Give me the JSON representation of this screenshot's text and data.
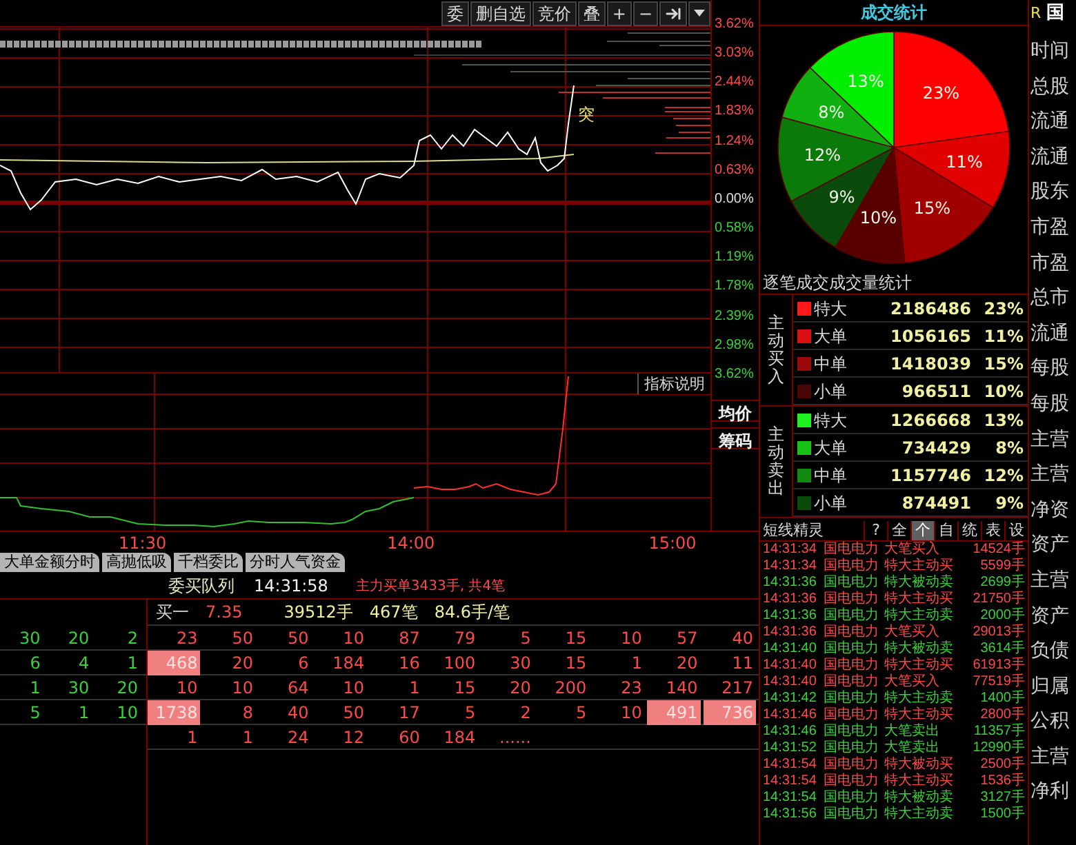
{
  "toolbar": [
    {
      "kind": "text",
      "label": "委"
    },
    {
      "kind": "text",
      "label": "删自选"
    },
    {
      "kind": "text",
      "label": "竞价"
    },
    {
      "kind": "text",
      "label": "叠"
    },
    {
      "kind": "text",
      "label": "+"
    },
    {
      "kind": "text",
      "label": "−"
    },
    {
      "kind": "jump-end"
    },
    {
      "kind": "dropdown"
    }
  ],
  "price_axis": [
    {
      "label": "3.62%",
      "kind": "up"
    },
    {
      "label": "3.03%",
      "kind": "up"
    },
    {
      "label": "2.44%",
      "kind": "up"
    },
    {
      "label": "1.83%",
      "kind": "up"
    },
    {
      "label": "1.24%",
      "kind": "up"
    },
    {
      "label": "0.63%",
      "kind": "up"
    },
    {
      "label": "0.00%",
      "kind": "flat"
    },
    {
      "label": "0.58%",
      "kind": "down"
    },
    {
      "label": "1.19%",
      "kind": "down"
    },
    {
      "label": "1.78%",
      "kind": "down"
    },
    {
      "label": "2.39%",
      "kind": "down"
    },
    {
      "label": "2.98%",
      "kind": "down"
    },
    {
      "label": "3.62%",
      "kind": "down"
    }
  ],
  "signal_label": "突",
  "indicator": {
    "help_button": "指标说明",
    "side_buttons": [
      "均价",
      "筹码"
    ]
  },
  "time_axis": [
    "11:30",
    "14:00",
    "15:00"
  ],
  "indicator_tabs": [
    "大单金额分时",
    "高抛低吸",
    "千档委比",
    "分时人气资金"
  ],
  "queue": {
    "title": "委买队列",
    "time": "14:31:58",
    "summary": "主力买单3433手, 共4笔",
    "level": "买一",
    "price": "7.35",
    "volume": "39512手",
    "count": "467笔",
    "average": "84.6手/笔",
    "side_rows": [
      [
        "30",
        "20",
        "2"
      ],
      [
        "6",
        "4",
        "1"
      ],
      [
        "1",
        "30",
        "20"
      ],
      [
        "5",
        "1",
        "10"
      ]
    ],
    "rows": [
      [
        {
          "text": "23",
          "highlighted": false
        },
        {
          "text": "50",
          "highlighted": false
        },
        {
          "text": "50",
          "highlighted": false
        },
        {
          "text": "10",
          "highlighted": false
        },
        {
          "text": "87",
          "highlighted": false
        },
        {
          "text": "79",
          "highlighted": false
        },
        {
          "text": "5",
          "highlighted": false
        },
        {
          "text": "15",
          "highlighted": false
        },
        {
          "text": "10",
          "highlighted": false
        },
        {
          "text": "57",
          "highlighted": false
        },
        {
          "text": "40",
          "highlighted": false
        }
      ],
      [
        {
          "text": "468",
          "highlighted": true
        },
        {
          "text": "20",
          "highlighted": false
        },
        {
          "text": "6",
          "highlighted": false
        },
        {
          "text": "184",
          "highlighted": false
        },
        {
          "text": "16",
          "highlighted": false
        },
        {
          "text": "100",
          "highlighted": false
        },
        {
          "text": "30",
          "highlighted": false
        },
        {
          "text": "15",
          "highlighted": false
        },
        {
          "text": "1",
          "highlighted": false
        },
        {
          "text": "20",
          "highlighted": false
        },
        {
          "text": "11",
          "highlighted": false
        }
      ],
      [
        {
          "text": "10",
          "highlighted": false
        },
        {
          "text": "10",
          "highlighted": false
        },
        {
          "text": "64",
          "highlighted": false
        },
        {
          "text": "10",
          "highlighted": false
        },
        {
          "text": "1",
          "highlighted": false
        },
        {
          "text": "15",
          "highlighted": false
        },
        {
          "text": "20",
          "highlighted": false
        },
        {
          "text": "200",
          "highlighted": false
        },
        {
          "text": "23",
          "highlighted": false
        },
        {
          "text": "140",
          "highlighted": false
        },
        {
          "text": "217",
          "highlighted": false
        }
      ],
      [
        {
          "text": "1738",
          "highlighted": true
        },
        {
          "text": "8",
          "highlighted": false
        },
        {
          "text": "40",
          "highlighted": false
        },
        {
          "text": "50",
          "highlighted": false
        },
        {
          "text": "17",
          "highlighted": false
        },
        {
          "text": "5",
          "highlighted": false
        },
        {
          "text": "2",
          "highlighted": false
        },
        {
          "text": "5",
          "highlighted": false
        },
        {
          "text": "10",
          "highlighted": false
        },
        {
          "text": "491",
          "highlighted": true
        },
        {
          "text": "736",
          "highlighted": true
        }
      ],
      [
        {
          "text": "1",
          "highlighted": false
        },
        {
          "text": "1",
          "highlighted": false
        },
        {
          "text": "24",
          "highlighted": false
        },
        {
          "text": "12",
          "highlighted": false
        },
        {
          "text": "60",
          "highlighted": false
        },
        {
          "text": "184",
          "highlighted": false
        },
        {
          "text": "......",
          "highlighted": false
        }
      ]
    ]
  },
  "trade_stats": {
    "title": "成交统计",
    "chart_data": {
      "type": "pie",
      "values": [
        23,
        11,
        15,
        10,
        9,
        12,
        8,
        13
      ],
      "colors": [
        "#ff0000",
        "#e00000",
        "#a00000",
        "#580000",
        "#0a4a0a",
        "#0a7a0a",
        "#10b010",
        "#00ee00"
      ],
      "value_labels": [
        "23%",
        "11%",
        "15%",
        "10%",
        "9%",
        "12%",
        "8%",
        "13%"
      ]
    },
    "subtitle": "逐笔成交成交量统计",
    "groups": [
      {
        "label": "主动买入",
        "rows": [
          {
            "name": "特大",
            "volume": "2186486",
            "share": "23%",
            "color": "#ff1a1a"
          },
          {
            "name": "大单",
            "volume": "1056165",
            "share": "11%",
            "color": "#d81010"
          },
          {
            "name": "中单",
            "volume": "1418039",
            "share": "15%",
            "color": "#9a0a0a"
          },
          {
            "name": "小单",
            "volume": "966511",
            "share": "10%",
            "color": "#4a0505"
          }
        ]
      },
      {
        "label": "主动卖出",
        "rows": [
          {
            "name": "特大",
            "volume": "1266668",
            "share": "13%",
            "color": "#20f020"
          },
          {
            "name": "大单",
            "volume": "734429",
            "share": "8%",
            "color": "#18c018"
          },
          {
            "name": "中单",
            "volume": "1157746",
            "share": "12%",
            "color": "#108a10"
          },
          {
            "name": "小单",
            "volume": "874491",
            "share": "9%",
            "color": "#0a4a0a"
          }
        ]
      }
    ]
  },
  "sprite": {
    "title": "短线精灵",
    "buttons": [
      {
        "label": "?",
        "selected": false
      },
      {
        "label": "全",
        "selected": false
      },
      {
        "label": "个",
        "selected": true
      },
      {
        "label": "自",
        "selected": false
      },
      {
        "label": "统",
        "selected": false
      },
      {
        "label": "表",
        "selected": false
      },
      {
        "label": "设",
        "selected": false
      }
    ],
    "rows": [
      {
        "time": "14:31:34",
        "stock": "国电电力",
        "event": "大笔买入",
        "volume": "14524手",
        "kind": "buy"
      },
      {
        "time": "14:31:34",
        "stock": "国电电力",
        "event": "特大主动买",
        "volume": "5599手",
        "kind": "buy"
      },
      {
        "time": "14:31:36",
        "stock": "国电电力",
        "event": "特大被动卖",
        "volume": "2699手",
        "kind": "sell"
      },
      {
        "time": "14:31:36",
        "stock": "国电电力",
        "event": "特大主动买",
        "volume": "21750手",
        "kind": "buy"
      },
      {
        "time": "14:31:36",
        "stock": "国电电力",
        "event": "特大主动卖",
        "volume": "2000手",
        "kind": "sell"
      },
      {
        "time": "14:31:36",
        "stock": "国电电力",
        "event": "大笔买入",
        "volume": "29013手",
        "kind": "buy"
      },
      {
        "time": "14:31:40",
        "stock": "国电电力",
        "event": "特大被动卖",
        "volume": "3614手",
        "kind": "sell"
      },
      {
        "time": "14:31:40",
        "stock": "国电电力",
        "event": "特大主动买",
        "volume": "61913手",
        "kind": "buy"
      },
      {
        "time": "14:31:40",
        "stock": "国电电力",
        "event": "大笔买入",
        "volume": "77519手",
        "kind": "buy"
      },
      {
        "time": "14:31:42",
        "stock": "国电电力",
        "event": "特大主动卖",
        "volume": "1400手",
        "kind": "sell"
      },
      {
        "time": "14:31:46",
        "stock": "国电电力",
        "event": "特大主动买",
        "volume": "2800手",
        "kind": "buy"
      },
      {
        "time": "14:31:46",
        "stock": "国电电力",
        "event": "大笔卖出",
        "volume": "11357手",
        "kind": "sell"
      },
      {
        "time": "14:31:52",
        "stock": "国电电力",
        "event": "大笔卖出",
        "volume": "12990手",
        "kind": "sell"
      },
      {
        "time": "14:31:54",
        "stock": "国电电力",
        "event": "特大被动买",
        "volume": "2500手",
        "kind": "buy"
      },
      {
        "time": "14:31:54",
        "stock": "国电电力",
        "event": "特大主动买",
        "volume": "1536手",
        "kind": "buy"
      },
      {
        "time": "14:31:54",
        "stock": "国电电力",
        "event": "特大被动卖",
        "volume": "3127手",
        "kind": "sell"
      },
      {
        "time": "14:31:56",
        "stock": "国电电力",
        "event": "特大主动卖",
        "volume": "1500手",
        "kind": "sell"
      }
    ]
  },
  "info_panel": {
    "marker": "R",
    "title": "国",
    "labels": [
      "时间",
      "总股",
      "流通",
      "流通",
      "股东",
      "市盈",
      "市盈",
      "总市",
      "流通",
      "每股",
      "每股",
      "主营",
      "主营",
      "净资",
      "资产",
      "主营",
      "资产",
      "负债",
      "归属",
      "公积",
      "主营",
      "净利"
    ]
  }
}
